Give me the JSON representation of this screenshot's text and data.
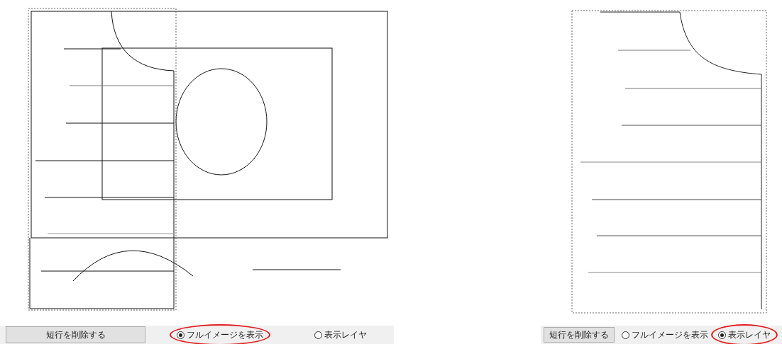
{
  "panels": [
    {
      "button": "短行を削除する",
      "options": [
        {
          "label": "フルイメージを表示",
          "selected": true
        },
        {
          "label": "表示レイヤ",
          "selected": false
        }
      ]
    },
    {
      "button": "短行を削除する",
      "options": [
        {
          "label": "フルイメージを表示",
          "selected": false
        },
        {
          "label": "表示レイヤ",
          "selected": true
        }
      ]
    }
  ]
}
